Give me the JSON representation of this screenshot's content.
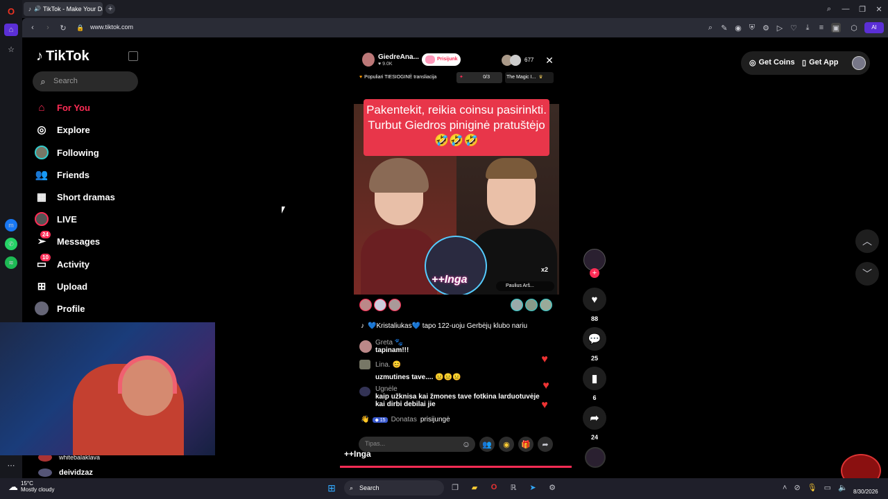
{
  "browser": {
    "tab_title": "TikTok - Make Your Da",
    "url": "www.tiktok.com",
    "ai_label": "AI"
  },
  "sidebar": {
    "logo": "TikTok",
    "search_placeholder": "Search",
    "items": [
      {
        "label": "For You",
        "icon": "home-icon",
        "active": true
      },
      {
        "label": "Explore",
        "icon": "compass-icon"
      },
      {
        "label": "Following",
        "icon": "following-avatar-icon"
      },
      {
        "label": "Friends",
        "icon": "friends-icon"
      },
      {
        "label": "Short dramas",
        "icon": "film-icon"
      },
      {
        "label": "LIVE",
        "icon": "live-avatar-icon"
      },
      {
        "label": "Messages",
        "icon": "send-icon",
        "badge": "24"
      },
      {
        "label": "Activity",
        "icon": "inbox-icon",
        "badge": "10"
      },
      {
        "label": "Upload",
        "icon": "plus-square-icon"
      },
      {
        "label": "Profile",
        "icon": "profile-avatar-icon"
      }
    ],
    "following_accounts": [
      "whitebalaklava",
      "deividzaz"
    ]
  },
  "header": {
    "get_coins": "Get Coins",
    "get_app": "Get App"
  },
  "live": {
    "host_name": "GiedreAna...",
    "host_likes": "9.0K",
    "join_button": "Prisijunk",
    "viewer_count": "677",
    "ranking_label": "Populiari TIESIOGINĖ transliacija",
    "goal_progress": "0/3",
    "goal_title": "The Magic I...",
    "caption": "Pakentekit, reikia coinsu pasirinkti. Turbut Giedros piniginė pratuštėjo 🤣🤣🤣",
    "sticker_name": "++Inga",
    "guest_name": "Paulius Arš...",
    "gift_multiplier": "x2",
    "chat": [
      {
        "type": "system",
        "text": "💙Kristaliukas💙 tapo 122-uoju Gerbėjų klubo nariu"
      },
      {
        "user": "Greta 🐾",
        "text": "tapinam!!!"
      },
      {
        "user": "Lina. 😊",
        "text": ""
      },
      {
        "user": "",
        "text": "uzmutines tave.... 😐😐😐"
      },
      {
        "user": "Ugnėle",
        "text": "kaip užknisa kai žmones tave fotkina larduotuvėje kai dirbi debilai jie"
      },
      {
        "type": "join",
        "level": "15",
        "user": "Donatas",
        "text": "prisijungė"
      }
    ],
    "comment_placeholder": "Tipas...",
    "bottom_label": "++Inga"
  },
  "actions": {
    "likes": "88",
    "comments": "25",
    "saves": "6",
    "shares": "24"
  },
  "taskbar": {
    "weather_temp": "15°C",
    "weather_desc": "Mostly cloudy",
    "search": "Search",
    "date": "8/30/2026"
  },
  "colors": {
    "accent": "#fe2c55",
    "caption_bg": "#e8364a",
    "background": "#000000"
  }
}
